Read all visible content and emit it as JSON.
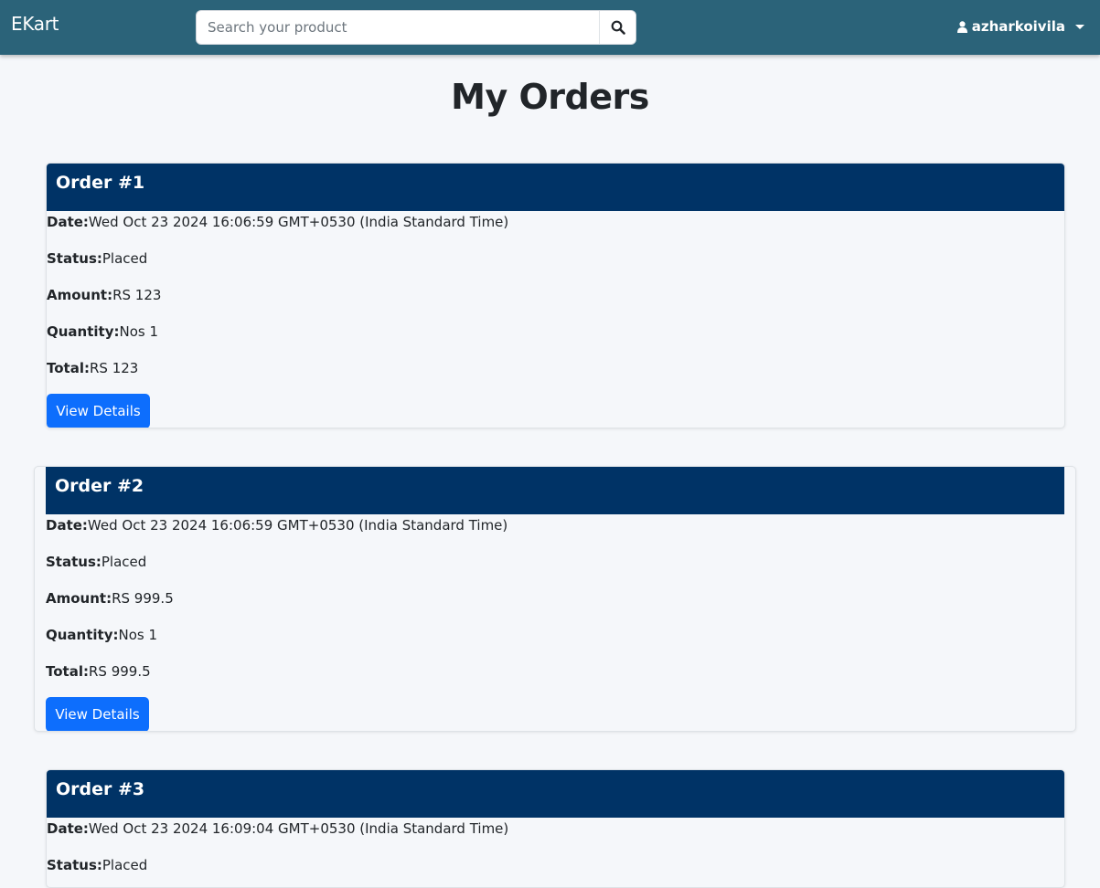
{
  "brand": "EKart",
  "search": {
    "placeholder": "Search your product"
  },
  "user": {
    "name": "azharkoivila"
  },
  "page_title": "My Orders",
  "labels": {
    "date": "Date:",
    "status": "Status:",
    "amount": "Amount:",
    "quantity": "Quantity:",
    "total": "Total:",
    "view_details": "View Details"
  },
  "orders": [
    {
      "title": "Order #1",
      "date": "Wed Oct 23 2024 16:06:59 GMT+0530 (India Standard Time)",
      "status": "Placed",
      "amount": "RS 123",
      "quantity": "Nos 1",
      "total": "RS 123"
    },
    {
      "title": "Order #2",
      "date": "Wed Oct 23 2024 16:06:59 GMT+0530 (India Standard Time)",
      "status": "Placed",
      "amount": "RS 999.5",
      "quantity": "Nos 1",
      "total": "RS 999.5"
    },
    {
      "title": "Order #3",
      "date": "Wed Oct 23 2024 16:09:04 GMT+0530 (India Standard Time)",
      "status": "Placed"
    }
  ],
  "colors": {
    "navbar": "#2b6379",
    "order_header": "#003366",
    "button": "#0d6efd"
  }
}
